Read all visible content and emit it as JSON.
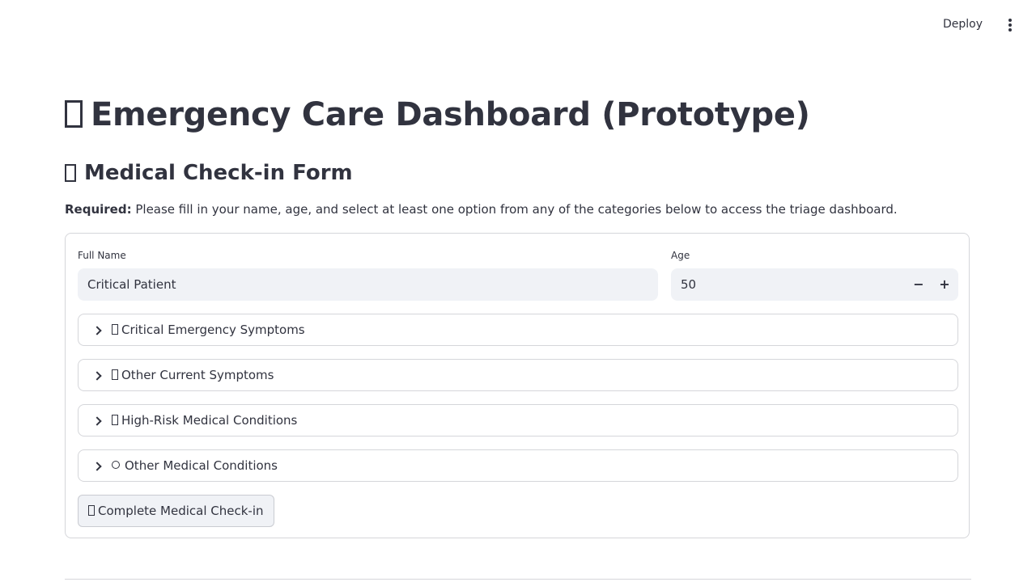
{
  "header": {
    "deploy_label": "Deploy",
    "menu_icon": "kebab-menu-icon"
  },
  "page": {
    "title": "Emergency Care Dashboard (Prototype)",
    "subtitle": "Medical Check-in Form",
    "required_label": "Required:",
    "required_text": " Please fill in your name, age, and select at least one option from any of the categories below to access the triage dashboard."
  },
  "form": {
    "name_label": "Full Name",
    "name_value": "Critical Patient",
    "age_label": "Age",
    "age_value": "50",
    "decrement_symbol": "−",
    "increment_symbol": "+",
    "expanders": [
      {
        "label": "Critical Emergency Symptoms",
        "icon": "missing-glyph-icon"
      },
      {
        "label": "Other Current Symptoms",
        "icon": "missing-glyph-icon"
      },
      {
        "label": "High-Risk Medical Conditions",
        "icon": "missing-glyph-icon"
      },
      {
        "label": "Other Medical Conditions",
        "icon": "circle-icon"
      }
    ],
    "submit_label": "Complete Medical Check-in"
  }
}
